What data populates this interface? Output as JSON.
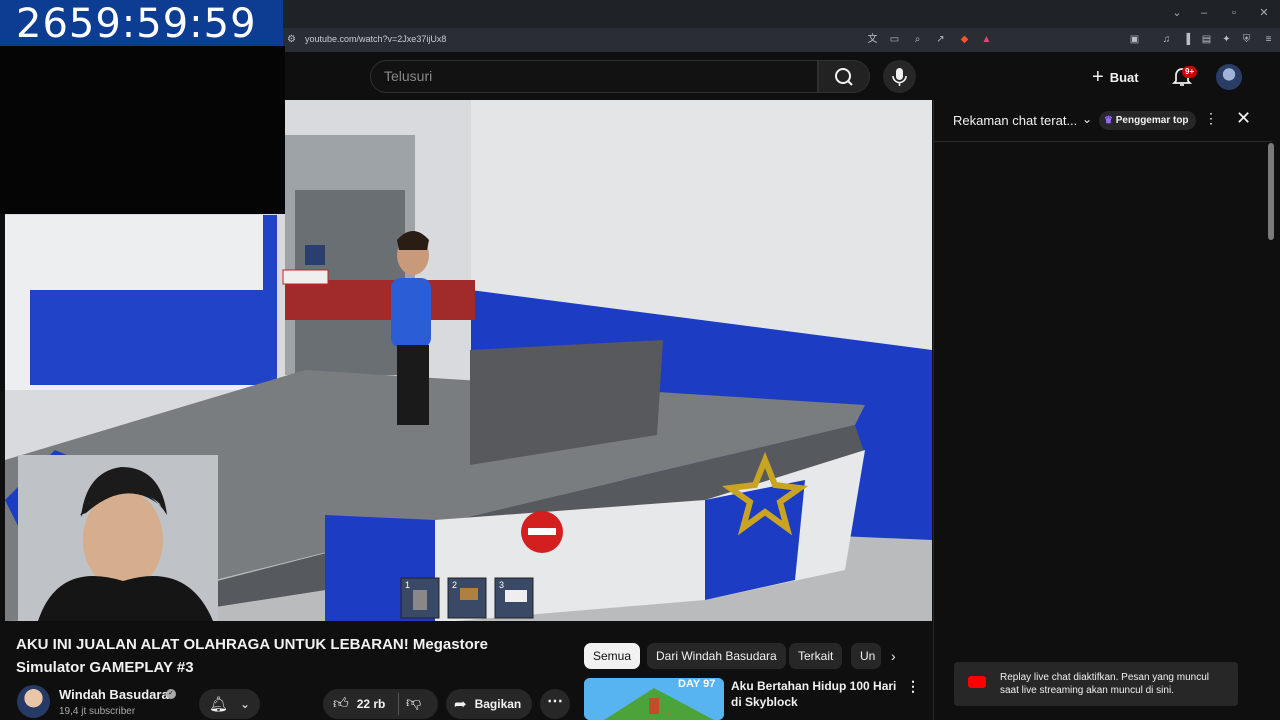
{
  "timer": "2659:59:59",
  "browser": {
    "url": "youtube.com/watch?v=2Jxe37ijUx8"
  },
  "masthead": {
    "search_placeholder": "Telusuri",
    "create_label": "Buat",
    "notification_badge": "9+"
  },
  "video": {
    "hotbar": [
      "1",
      "2",
      "3"
    ]
  },
  "chat": {
    "title": "Rekaman chat terat...",
    "filter_chip": "Penggemar top",
    "toast": "Replay live chat diaktifkan. Pesan yang muncul saat live streaming akan muncul di sini."
  },
  "info": {
    "title": "AKU INI JUALAN ALAT OLAHRAGA UNTUK LEBARAN! Megastore Simulator GAMEPLAY #3",
    "channel_name": "Windah Basudara",
    "subscribers": "19,4 jt subscriber",
    "like_count": "22 rb",
    "share_label": "Bagikan"
  },
  "chips": [
    "Semua",
    "Dari Windah Basudara",
    "Terkait",
    "Un"
  ],
  "recommended": {
    "thumb_label": "DAY 97",
    "title": "Aku Bertahan Hidup 100 Hari di Skyblock"
  },
  "colors": {
    "timer_bg": "#0d3d92",
    "youtube_red": "#ff0000",
    "badge_red": "#cc0000",
    "bg": "#0f0f0f"
  }
}
